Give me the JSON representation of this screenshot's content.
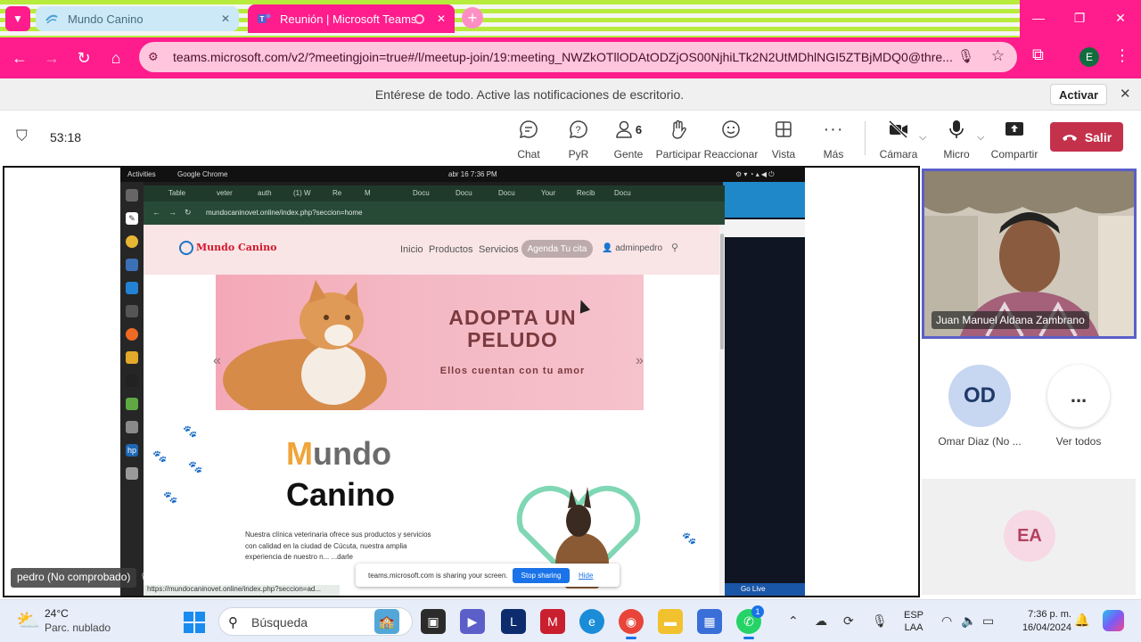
{
  "browser": {
    "tabs": [
      {
        "title": "Mundo Canino",
        "active": false
      },
      {
        "title": "Reunión | Microsoft Teams",
        "active": true
      }
    ],
    "url": "teams.microsoft.com/v2/?meetingjoin=true#/l/meetup-join/19:meeting_NWZkOTllODAtODZjOS00NjhiLTk2N2UtMDhlNGI5ZTBjMDQ0@thre...",
    "profile_initial": "E",
    "accent": "#ff1c8c"
  },
  "notification": {
    "message": "Entérese de todo. Active las notificaciones de escritorio.",
    "action": "Activar"
  },
  "meeting": {
    "timer": "53:18",
    "controls": [
      {
        "label": "Chat",
        "icon": "chat-icon"
      },
      {
        "label": "PyR",
        "icon": "qa-icon"
      },
      {
        "label": "Gente",
        "icon": "people-icon",
        "count": "6"
      },
      {
        "label": "Participar",
        "icon": "raise-hand-icon"
      },
      {
        "label": "Reaccionar",
        "icon": "smile-icon"
      },
      {
        "label": "Vista",
        "icon": "grid-icon"
      },
      {
        "label": "Más",
        "icon": "more-icon"
      },
      {
        "label": "Cámara",
        "icon": "camera-off-icon"
      },
      {
        "label": "Micro",
        "icon": "mic-icon"
      },
      {
        "label": "Compartir",
        "icon": "share-icon"
      }
    ],
    "leave": "Salir",
    "leave_color": "#c4314b"
  },
  "shared_screen": {
    "presenter": "pedro (No comprobado)",
    "topbar": {
      "activities": "Activities",
      "app": "Google Chrome",
      "datetime": "abr 16  7:36 PM"
    },
    "inner_tabs": [
      "Table",
      "veter",
      "auth",
      "(1) W",
      "Re",
      "M",
      "Docu",
      "Docu",
      "Docu",
      "Your",
      "Recib",
      "Docu"
    ],
    "inner_url": "mundocaninovet.online/index.php?seccion=home",
    "site": {
      "logo": "Mundo Canino",
      "nav": [
        "Inicio",
        "Productos",
        "Servicios"
      ],
      "cta": "Agenda Tu cita",
      "user": "adminpedro",
      "hero_title_1": "ADOPTA UN",
      "hero_title_2": "PELUDO",
      "hero_subtitle": "Ellos cuentan con tu amor",
      "about_title_1a": "M",
      "about_title_1b": "undo",
      "about_title_2": "Canino",
      "about_text": "Nuestra clínica veterinaria ofrece sus productos y servicios con calidad en la ciudad de Cúcuta, nuestra amplia experiencia de nuestro n... ...darle"
    },
    "sharing_bar": {
      "text": "teams.microsoft.com is sharing your screen.",
      "stop": "Stop sharing",
      "hide": "Hide"
    },
    "status_url": "https://mundocaninovet.online/index.php?seccion=ad...",
    "go_live": "Go Live"
  },
  "participants": {
    "featured": "Juan Manuel Aldana Zambrano",
    "others": [
      {
        "initials": "OD",
        "name": "Omar Diaz (No ..."
      },
      {
        "initials": "...",
        "name": "Ver todos"
      },
      {
        "initials": "EA",
        "name": ""
      }
    ]
  },
  "taskbar": {
    "weather_temp": "24°C",
    "weather_desc": "Parc. nublado",
    "search": "Búsqueda",
    "lang_1": "ESP",
    "lang_2": "LAA",
    "time": "7:36 p. m.",
    "date": "16/04/2024",
    "whatsapp_badge": "1"
  }
}
